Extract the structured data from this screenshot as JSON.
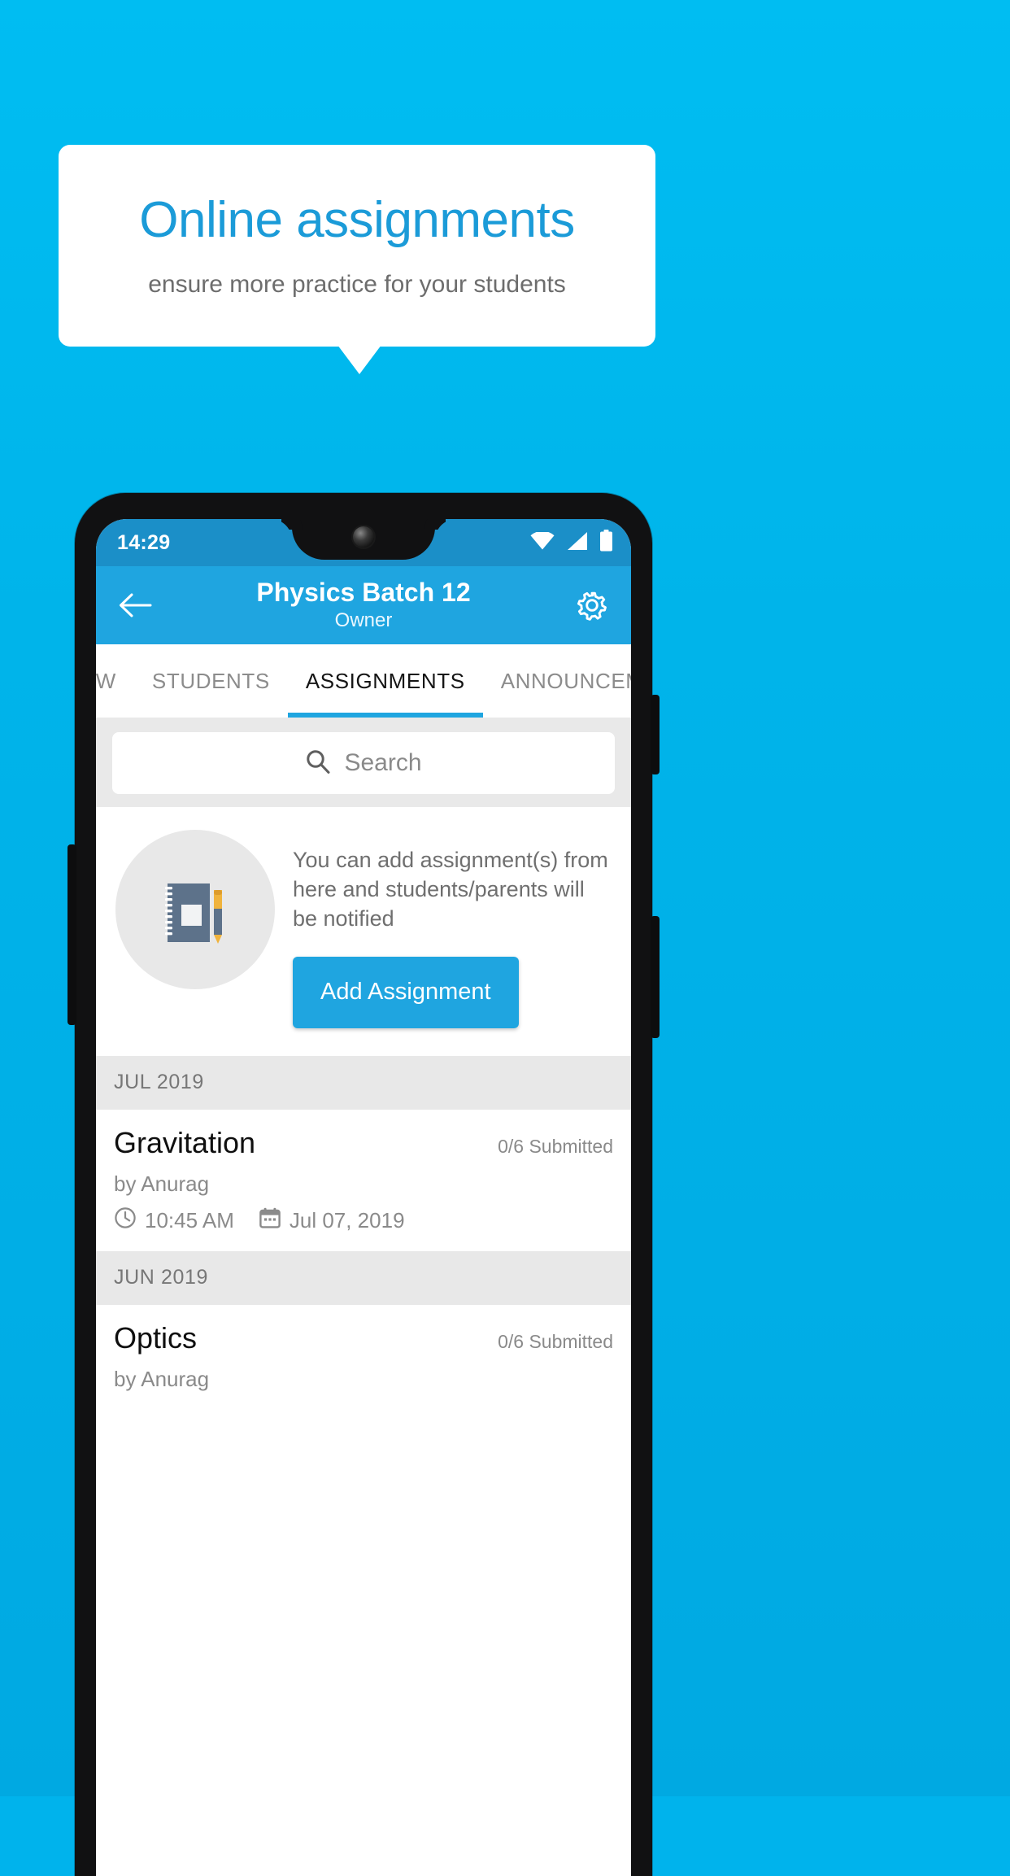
{
  "banner": {
    "title": "Online assignments",
    "subtitle": "ensure more practice for your students"
  },
  "colors": {
    "background": "#00b4ea",
    "accent": "#1fa5e0",
    "banner_title": "#1b9bd8",
    "statusbar": "#1b8fc8",
    "muted_text": "#8a8a8a",
    "group_header_bg": "#e8e8e8"
  },
  "phone": {
    "statusbar": {
      "time": "14:29",
      "icons": [
        "wifi-icon",
        "signal-icon",
        "battery-icon"
      ]
    },
    "appbar": {
      "back_icon": "back-arrow-icon",
      "title": "Physics Batch 12",
      "subtitle": "Owner",
      "settings_icon": "gear-icon"
    },
    "tabs": [
      {
        "label": "IEW",
        "active": false
      },
      {
        "label": "STUDENTS",
        "active": false
      },
      {
        "label": "ASSIGNMENTS",
        "active": true
      },
      {
        "label": "ANNOUNCEMENTS",
        "active": false
      }
    ],
    "search": {
      "icon": "search-icon",
      "placeholder": "Search",
      "value": ""
    },
    "empty_state": {
      "illustration": "notebook-and-pen-icon",
      "text": "You can add assignment(s) from here and students/parents will be notified",
      "button_label": "Add Assignment"
    },
    "groups": [
      {
        "header": "JUL 2019",
        "items": [
          {
            "title": "Gravitation",
            "submitted": "0/6 Submitted",
            "author": "by Anurag",
            "time_icon": "clock-icon",
            "time": "10:45 AM",
            "date_icon": "calendar-icon",
            "date": "Jul 07, 2019"
          }
        ]
      },
      {
        "header": "JUN 2019",
        "items": [
          {
            "title": "Optics",
            "submitted": "0/6 Submitted",
            "author": "by Anurag",
            "time_icon": "clock-icon",
            "time": "",
            "date_icon": "calendar-icon",
            "date": ""
          }
        ]
      }
    ]
  }
}
